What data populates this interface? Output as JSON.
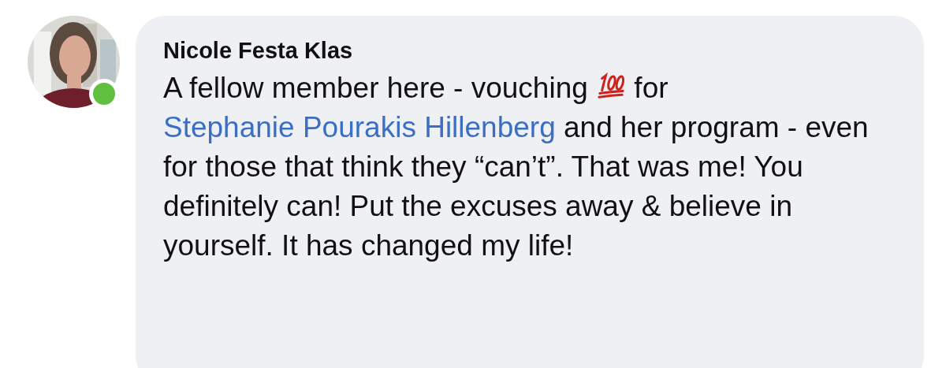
{
  "comment": {
    "author": "Nicole Festa Klas",
    "online": true,
    "body": [
      {
        "kind": "text",
        "text": "A fellow member here - vouching "
      },
      {
        "kind": "icon"
      },
      {
        "kind": "text",
        "text": " for "
      },
      {
        "kind": "link",
        "text": "Stephanie Pourakis Hillenberg"
      },
      {
        "kind": "text",
        "text": " and her program - even for those that think they “can’t”. That was me! You definitely can! Put the excuses away & believe in yourself. It has changed my life!"
      }
    ]
  }
}
